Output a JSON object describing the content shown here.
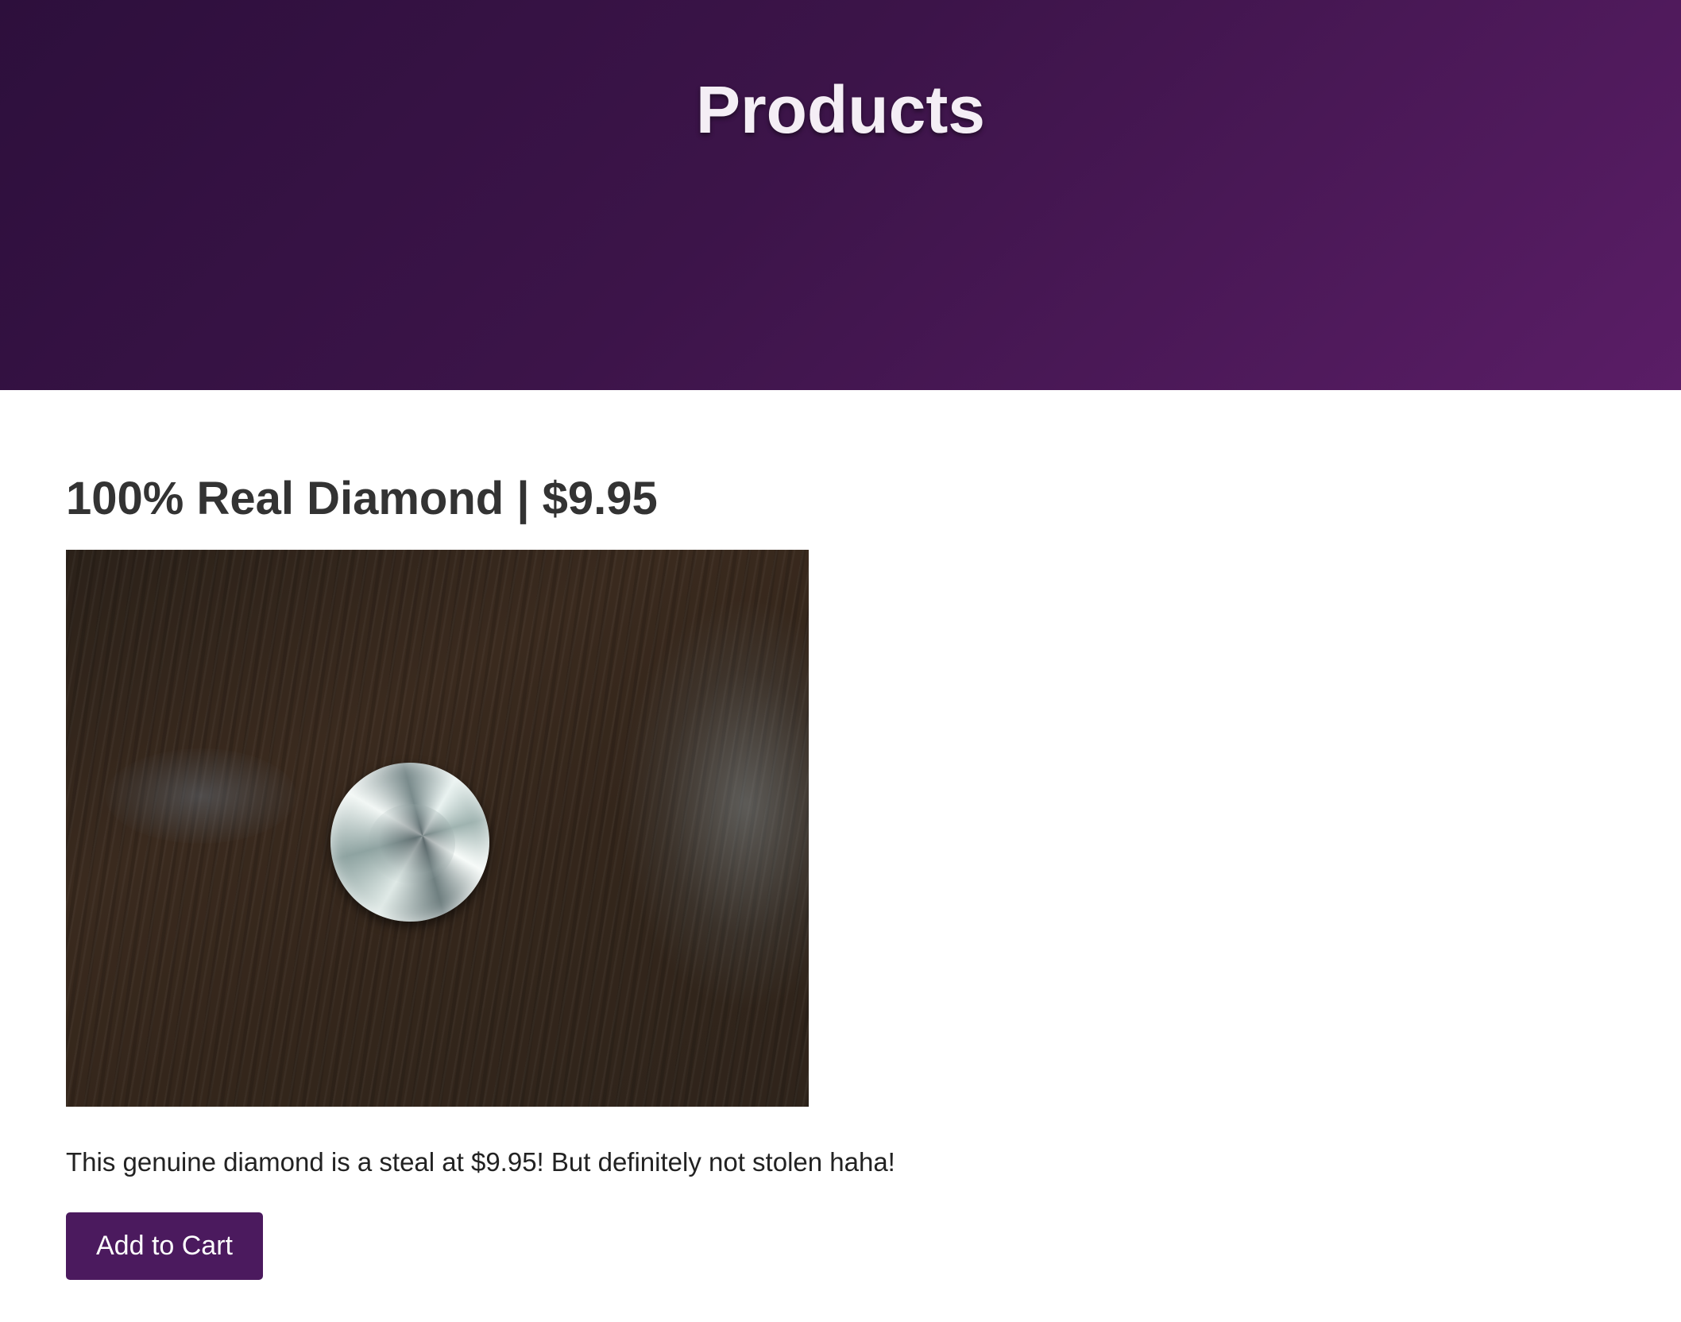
{
  "header": {
    "title": "Products"
  },
  "product": {
    "title": "100% Real Diamond | $9.95",
    "image_alt": "diamond on wooden table",
    "description": "This genuine diamond is a steal at $9.95! But definitely not stolen haha!",
    "add_to_cart_label": "Add to Cart"
  },
  "colors": {
    "hero_gradient_start": "#2d0f3c",
    "hero_gradient_end": "#5a1d66",
    "button_background": "#4b1a5e",
    "title_text": "#333333"
  }
}
